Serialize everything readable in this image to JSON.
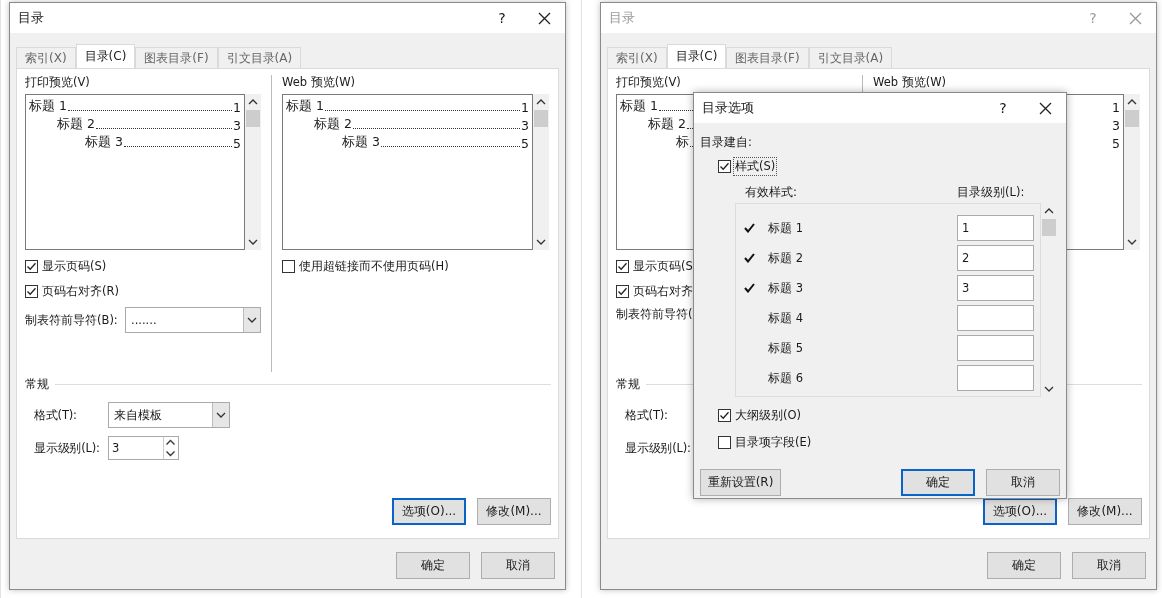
{
  "dialogs": [
    {
      "title": "目录",
      "help": "?",
      "active": true,
      "tabs": [
        {
          "label": "索引(X)",
          "selected": false
        },
        {
          "label": "目录(C)",
          "selected": true
        },
        {
          "label": "图表目录(F)",
          "selected": false
        },
        {
          "label": "引文目录(A)",
          "selected": false
        }
      ],
      "print_preview": {
        "label": "打印预览(V)",
        "entries": [
          {
            "text": "标题 1",
            "page": "1",
            "children": [
              {
                "text": "标题 2",
                "page": "3",
                "children": [
                  {
                    "text": "标题 3",
                    "page": "5"
                  }
                ]
              }
            ]
          }
        ]
      },
      "web_preview": {
        "label": "Web 预览(W)",
        "entries": [
          {
            "text": "标题 1",
            "page": "1",
            "children": [
              {
                "text": "标题 2",
                "page": "3",
                "children": [
                  {
                    "text": "标题 3",
                    "page": "5"
                  }
                ]
              }
            ]
          }
        ]
      },
      "show_page_numbers": {
        "label": "显示页码(S)",
        "checked": true
      },
      "right_align": {
        "label": "页码右对齐(R)",
        "checked": true
      },
      "hyperlinks": {
        "label": "使用超链接而不使用页码(H)",
        "checked": false
      },
      "tab_leader": {
        "label": "制表符前导符(B):",
        "value": "......."
      },
      "general": {
        "heading": "常规",
        "format": {
          "label": "格式(T):",
          "value": "来自模板"
        },
        "levels": {
          "label": "显示级别(L):",
          "value": "3"
        }
      },
      "buttons": [
        {
          "label": "选项(O)...",
          "focused": true
        },
        {
          "label": "修改(M)...",
          "focused": false
        }
      ],
      "footer_buttons": [
        {
          "label": "确定",
          "focused": false
        },
        {
          "label": "取消",
          "focused": false
        }
      ]
    },
    {
      "title": "目录",
      "help": "?",
      "active": false,
      "tabs": [
        {
          "label": "索引(X)",
          "selected": false
        },
        {
          "label": "目录(C)",
          "selected": true
        },
        {
          "label": "图表目录(F)",
          "selected": false
        },
        {
          "label": "引文目录(A)",
          "selected": false
        }
      ],
      "print_preview": {
        "label": "打印预览(V)",
        "entries": [
          {
            "text": "标题 1",
            "children": [
              {
                "text": "标题 2",
                "children": [
                  {
                    "text": "标"
                  }
                ]
              }
            ]
          }
        ]
      },
      "web_preview": {
        "label": "Web 预览(W)",
        "entries": [
          {
            "page": "1"
          },
          {
            "page": "3"
          },
          {
            "page": "5"
          }
        ]
      },
      "show_page_numbers": {
        "label": "显示页码(S",
        "checked": true
      },
      "right_align": {
        "label": "页码右对齐",
        "checked": true
      },
      "tab_leader": {
        "label": "制表符前导符("
      },
      "general": {
        "heading": "常规",
        "format": {
          "label": "格式(T):"
        },
        "levels": {
          "label": "显示级别(L):"
        }
      },
      "buttons": [
        {
          "label": "选项(O)...",
          "focused": true
        },
        {
          "label": "修改(M)...",
          "focused": false
        }
      ],
      "footer_buttons": [
        {
          "label": "确定",
          "focused": false
        },
        {
          "label": "取消",
          "focused": false
        }
      ],
      "options_dialog": {
        "title": "目录选项",
        "help": "?",
        "build_from": "目录建自:",
        "styles": {
          "label": "样式(S)",
          "checked": true
        },
        "columns": [
          "有效样式:",
          "目录级别(L):"
        ],
        "rows": [
          {
            "name": "标题 1",
            "checked": true,
            "toc_level": "1"
          },
          {
            "name": "标题 2",
            "checked": true,
            "toc_level": "2"
          },
          {
            "name": "标题 3",
            "checked": true,
            "toc_level": "3"
          },
          {
            "name": "标题 4",
            "checked": false
          },
          {
            "name": "标题 5",
            "checked": false
          },
          {
            "name": "标题 6",
            "checked": false
          }
        ],
        "outline_levels": {
          "label": "大纲级别(O)",
          "checked": true
        },
        "entry_fields": {
          "label": "目录项字段(E)",
          "checked": false
        },
        "buttons": [
          {
            "label": "重新设置(R)",
            "focused": false
          }
        ],
        "footer_buttons": [
          {
            "label": "确定",
            "focused": true
          },
          {
            "label": "取消",
            "focused": false
          }
        ]
      }
    }
  ]
}
